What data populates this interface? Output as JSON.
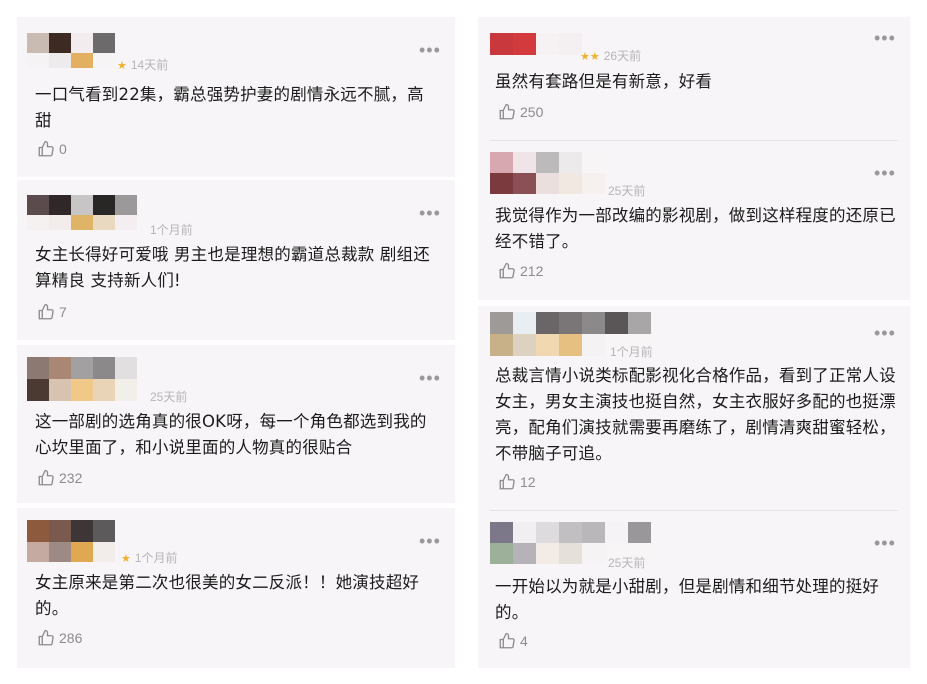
{
  "colors": {
    "star": "#f0b12b",
    "card_bg": "#f7f5f7",
    "meta": "#b7b4b7"
  },
  "icons": {
    "like": "thumbs-up-outline-icon",
    "more": "more-dots-icon"
  },
  "comments": [
    {
      "time": "14天前",
      "rating": 1,
      "text": "一口气看到22集，霸总强势护妻的剧情永远不腻，高甜",
      "likes": "0"
    },
    {
      "time": "1个月前",
      "rating": 0,
      "text": "女主长得好可爱哦 男主也是理想的霸道总裁款 剧组还算精良 支持新人们!",
      "likes": "7"
    },
    {
      "time": "25天前",
      "rating": 0,
      "text": "这一部剧的选角真的很OK呀，每一个角色都选到我的心坎里面了，和小说里面的人物真的很贴合",
      "likes": "232"
    },
    {
      "time": "1个月前",
      "rating": 1,
      "text": "女主原来是第二次也很美的女二反派！！她演技超好的。",
      "likes": "286"
    },
    {
      "time": "26天前",
      "rating": 2,
      "text": "虽然有套路但是有新意，好看",
      "likes": "250"
    },
    {
      "time": "25天前",
      "rating": 0,
      "text": "我觉得作为一部改编的影视剧，做到这样程度的还原已经不错了。",
      "likes": "212"
    },
    {
      "time": "1个月前",
      "rating": 0,
      "text": "总裁言情小说类标配影视化合格作品，看到了正常人设女主，男女主演技也挺自然，女主衣服好多配的也挺漂亮，配角们演技就需要再磨练了，剧情清爽甜蜜轻松，不带脑子可追。",
      "likes": "12"
    },
    {
      "time": "25天前",
      "rating": 0,
      "text": "一开始以为就是小甜剧，但是剧情和细节处理的挺好的。",
      "likes": "4"
    }
  ]
}
